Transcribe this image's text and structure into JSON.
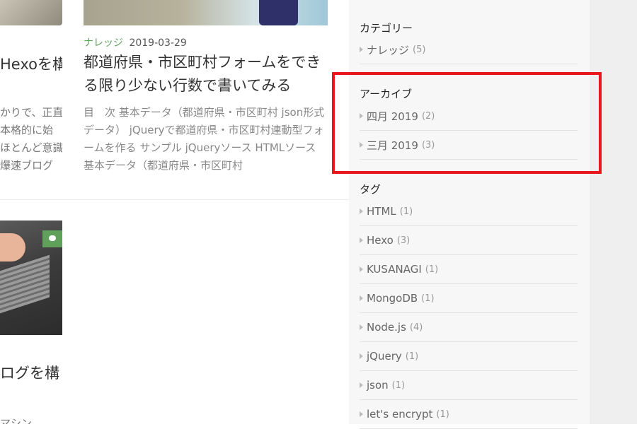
{
  "left_fragments": {
    "title1": "Hexoを構",
    "lines1": [
      "かりで、正直",
      "本格的に始",
      "ほとんど意識",
      "爆速ブログ"
    ],
    "title2": "ログを構",
    "line2": "マシン"
  },
  "post": {
    "category": "ナレッジ",
    "date": "2019-03-29",
    "title": "都道府県・市区町村フォームをできる限り少ない行数で書いてみる",
    "excerpt": "目　次 基本データ（都道府県・市区町村 json形式データ） jQueryで都道府県・市区町村連動型フォームを作る サンプル jQueryソース HTMLソース 基本データ（都道府県・市区町村"
  },
  "sidebar": {
    "categories": {
      "title": "カテゴリー",
      "items": [
        {
          "label": "ナレッジ",
          "count": "(5)"
        }
      ]
    },
    "archives": {
      "title": "アーカイブ",
      "items": [
        {
          "label": "四月 2019",
          "count": "(2)"
        },
        {
          "label": "三月 2019",
          "count": "(3)"
        }
      ]
    },
    "tags": {
      "title": "タグ",
      "items": [
        {
          "label": "HTML",
          "count": "(1)"
        },
        {
          "label": "Hexo",
          "count": "(3)"
        },
        {
          "label": "KUSANAGI",
          "count": "(1)"
        },
        {
          "label": "MongoDB",
          "count": "(1)"
        },
        {
          "label": "Node.js",
          "count": "(4)"
        },
        {
          "label": "jQuery",
          "count": "(1)"
        },
        {
          "label": "json",
          "count": "(1)"
        },
        {
          "label": "let's encrypt",
          "count": "(1)"
        }
      ]
    }
  },
  "colors": {
    "accent_green": "#5fa15a",
    "highlight_red": "#e8171b"
  }
}
